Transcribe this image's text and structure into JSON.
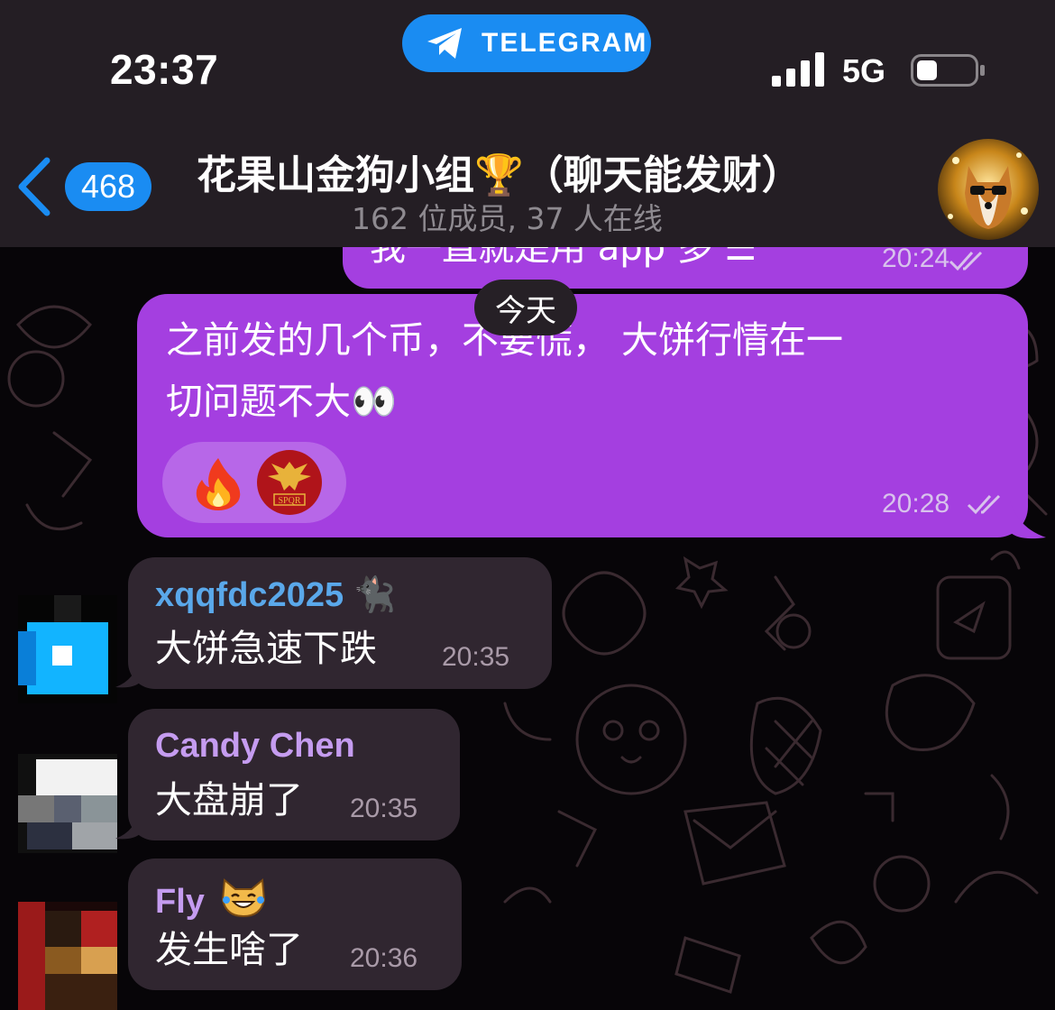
{
  "status_bar": {
    "time": "23:37",
    "app_pill": "TELEGRAM",
    "network": "5G"
  },
  "header": {
    "back_count": "468",
    "title": "花果山金狗小组🏆（聊天能发财）",
    "subtitle": "162 位成员, 37 人在线"
  },
  "messages": {
    "partial_prev": {
      "text": "我一直就是用 app 多 ☰",
      "time": "20:24"
    },
    "date_separator": "今天",
    "outgoing": {
      "line1": "之前发的几个币，不要慌， 大饼行情在一",
      "line2": "切问题不大👀",
      "time": "20:28",
      "reactions": [
        "fire-emoji",
        "spqr-eagle-emoji"
      ]
    },
    "incoming": [
      {
        "sender": "xqqfdc2025 🐈‍⬛",
        "text": "大饼急速下跌",
        "time": "20:35",
        "sender_color": "#5aa8ea"
      },
      {
        "sender": "Candy Chen",
        "text": "大盘崩了",
        "time": "20:35",
        "sender_color": "#c59cf0"
      },
      {
        "sender": "Fly",
        "text": "发生啥了",
        "time": "20:36",
        "sender_color": "#c59cf0"
      }
    ]
  },
  "colors": {
    "accent_blue": "#1a8cf2",
    "outgoing_bubble": "#a43fe0",
    "incoming_bubble": "#302630",
    "header_bg": "#241e24"
  }
}
